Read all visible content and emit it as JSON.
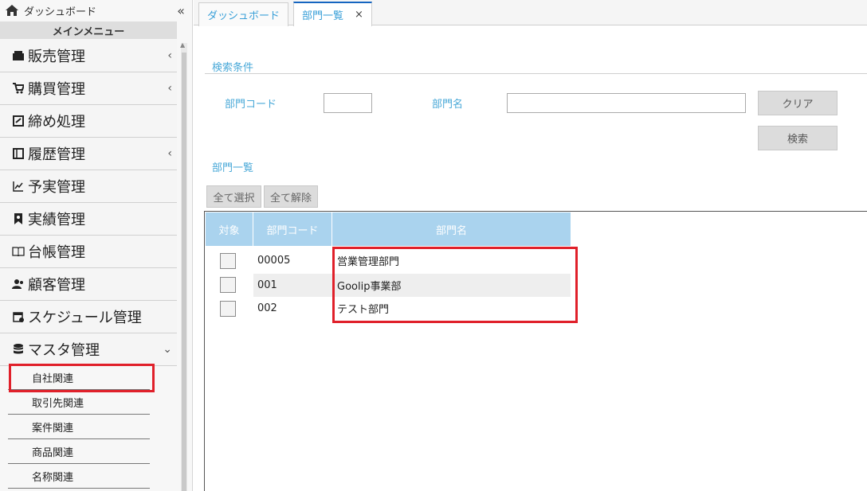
{
  "sidebar": {
    "home_label": "ダッシュボード",
    "collapse_label": "«",
    "main_menu_title": "メインメニュー",
    "items": [
      {
        "label": "販売管理",
        "icon": "register-icon",
        "arrow": "‹"
      },
      {
        "label": "購買管理",
        "icon": "cart-icon",
        "arrow": "‹"
      },
      {
        "label": "締め処理",
        "icon": "checkbox-icon",
        "arrow": ""
      },
      {
        "label": "履歴管理",
        "icon": "book-icon",
        "arrow": "‹"
      },
      {
        "label": "予実管理",
        "icon": "chart-line-icon",
        "arrow": ""
      },
      {
        "label": "実績管理",
        "icon": "bookmark-icon",
        "arrow": ""
      },
      {
        "label": "台帳管理",
        "icon": "open-book-icon",
        "arrow": ""
      },
      {
        "label": "顧客管理",
        "icon": "users-icon",
        "arrow": ""
      },
      {
        "label": "スケジュール管理",
        "icon": "calendar-icon",
        "arrow": ""
      },
      {
        "label": "マスタ管理",
        "icon": "database-icon",
        "arrow": "⌄"
      }
    ],
    "sub_items": [
      "自社関連",
      "取引先関連",
      "案件関連",
      "商品関連",
      "名称関連"
    ]
  },
  "tabs": [
    {
      "label": "ダッシュボード"
    },
    {
      "label": "部門一覧",
      "close": "×"
    }
  ],
  "search": {
    "section_title": "検索条件",
    "code_label": "部門コード",
    "code_value": "",
    "name_label": "部門名",
    "name_value": "",
    "clear_button": "クリア",
    "search_button": "検索"
  },
  "list": {
    "section_title": "部門一覧",
    "select_all": "全て選択",
    "deselect_all": "全て解除",
    "headers": [
      "対象",
      "部門コード",
      "部門名"
    ],
    "rows": [
      {
        "code": "00005",
        "name": "営業管理部門"
      },
      {
        "code": "001",
        "name": "Goolip事業部"
      },
      {
        "code": "002",
        "name": "テスト部門"
      }
    ]
  },
  "colors": {
    "accent": "#4aa9d8",
    "header_bg": "#aad3ee",
    "highlight": "#e0202a",
    "active_tab_border": "#1565c0"
  }
}
